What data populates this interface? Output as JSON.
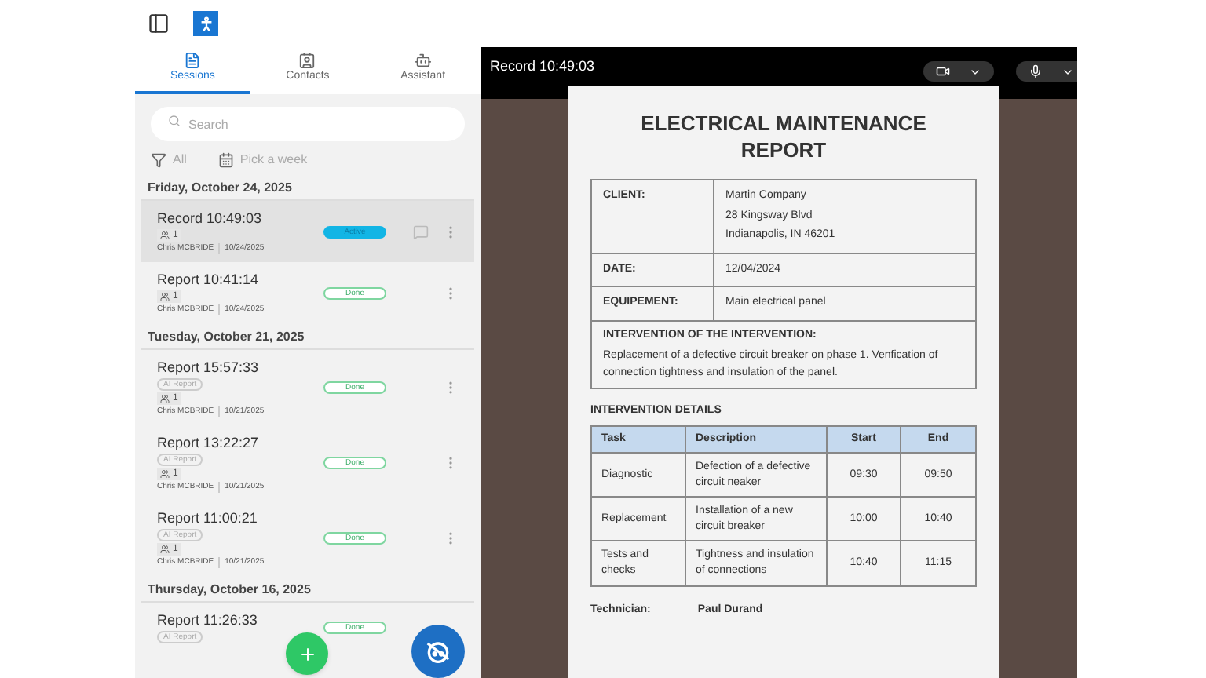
{
  "tabs": [
    {
      "label": "Sessions",
      "selected": true
    },
    {
      "label": "Contacts",
      "selected": false
    },
    {
      "label": "Assistant",
      "selected": false
    }
  ],
  "search": {
    "placeholder": "Search"
  },
  "filters": {
    "type": "All",
    "week": "Pick a week"
  },
  "groups": [
    {
      "date": "Friday, October 24, 2025",
      "sessions": [
        {
          "title": "Record 10:49:03",
          "people": "1",
          "author": "Chris MCBRIDE",
          "date": "10/24/2025",
          "status": "Active",
          "kind": "active",
          "selected": true,
          "comments": true
        },
        {
          "title": "Report 10:41:14",
          "people": "1",
          "author": "Chris MCBRIDE",
          "date": "10/24/2025",
          "status": "Done",
          "kind": "done",
          "selected": false,
          "comments": false
        }
      ]
    },
    {
      "date": "Tuesday, October 21, 2025",
      "sessions": [
        {
          "title": "Report 15:57:33",
          "tag": "AI Report",
          "people": "1",
          "author": "Chris MCBRIDE",
          "date": "10/21/2025",
          "status": "Done",
          "kind": "done",
          "selected": false,
          "comments": false
        },
        {
          "title": "Report 13:22:27",
          "tag": "AI Report",
          "people": "1",
          "author": "Chris MCBRIDE",
          "date": "10/21/2025",
          "status": "Done",
          "kind": "done",
          "selected": false,
          "comments": false
        },
        {
          "title": "Report 11:00:21",
          "tag": "AI Report",
          "people": "1",
          "author": "Chris MCBRIDE",
          "date": "10/21/2025",
          "status": "Done",
          "kind": "done",
          "selected": false,
          "comments": false
        }
      ]
    },
    {
      "date": "Thursday, October 16, 2025",
      "sessions": [
        {
          "title": "Report 11:26:33",
          "tag": "AI Report",
          "status": "Done",
          "more_menu": false,
          "kind": "done",
          "selected": false,
          "comments": false
        }
      ]
    }
  ],
  "viewer": {
    "title": "Record 10:49:03"
  },
  "document": {
    "title": "ELECTRICAL MAINTENANCE REPORT",
    "fields": [
      {
        "label": "CLIENT:",
        "lines": [
          "Martin Company",
          "28 Kingsway Blvd",
          "Indianapolis, IN 46201"
        ]
      },
      {
        "label": "DATE:",
        "lines": [
          "12/04/2024"
        ]
      },
      {
        "label": "EQUIPEMENT:",
        "lines": [
          "Main electrical panel"
        ]
      }
    ],
    "intervention": {
      "heading": "INTERVENTION OF THE INTERVENTION:",
      "text": "Replacement of a defective circuit breaker on phase 1. Venfication of connection tightness and insulation  of the panel."
    },
    "details_heading": "INTERVENTION DETAILS",
    "columns": [
      "Task",
      "Description",
      "Start",
      "End"
    ],
    "rows": [
      [
        "Diagnostic",
        "Defection of a defective circuit neaker",
        "09:30",
        "09:50"
      ],
      [
        "Replacement",
        "Installation of a new circuit breaker",
        "10:00",
        "10:40"
      ],
      [
        "Tests and checks",
        "Tightness and insulation of connections",
        "10:40",
        "11:15"
      ]
    ],
    "technician_label": "Technician:",
    "technician": "Paul Durand"
  }
}
